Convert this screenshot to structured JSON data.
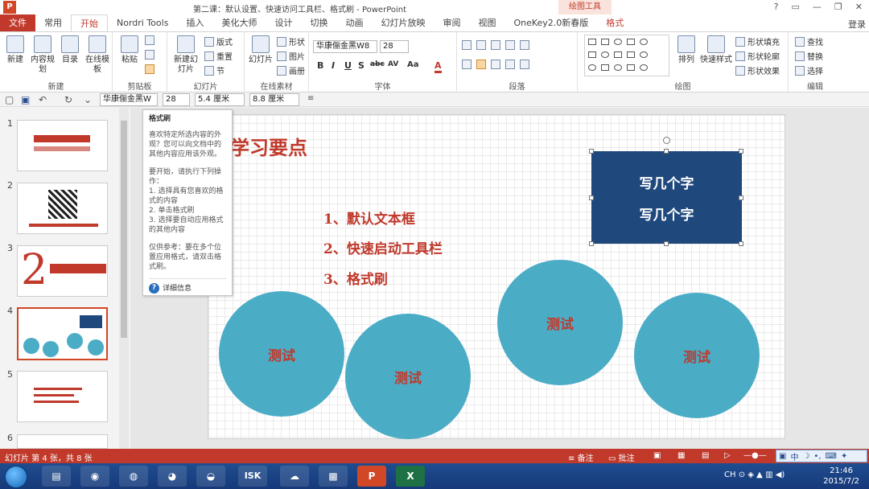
{
  "window": {
    "title": "第二课：默认设置、快速访问工具栏、格式刷 - PowerPoint",
    "contextual_label": "绘图工具",
    "controls": [
      "?",
      "▭",
      "—",
      "❐",
      "✕"
    ],
    "login": "登录"
  },
  "tabs": [
    "文件",
    "常用",
    "开始",
    "Nordri Tools",
    "插入",
    "美化大师",
    "设计",
    "切换",
    "动画",
    "幻灯片放映",
    "审阅",
    "视图",
    "OneKey2.0新春版",
    "格式"
  ],
  "ribbon": {
    "groups": {
      "new": "新建",
      "clipboard": "剪贴板",
      "slides": "幻灯片",
      "online": "在线素材",
      "font": "字体",
      "paragraph": "段落",
      "drawing": "绘图",
      "editing": "编辑"
    },
    "buttons": {
      "new": "新建",
      "content_plan": "内容规划",
      "toc": "目录",
      "online_template": "在线模板",
      "paste": "粘贴",
      "new_slide": "新建幻灯片",
      "layout": "版式",
      "reset": "重置",
      "section": "节",
      "slideshow": "幻灯片",
      "shape": "形状",
      "picture": "图片",
      "album": "画册",
      "arrange": "排列",
      "quick_styles": "快速样式",
      "shape_fill": "形状填充",
      "shape_outline": "形状轮廓",
      "shape_effects": "形状效果",
      "find": "查找",
      "replace": "替换",
      "select": "选择"
    },
    "font_name": "华康俪金黑W8",
    "font_size": "28",
    "fmt_buttons": [
      "B",
      "I",
      "U",
      "S",
      "abc",
      "AV",
      "Aa",
      "A"
    ]
  },
  "qat": {
    "font_name": "华康俪金黑W",
    "font_size": "28",
    "width": "5.4 厘米",
    "height": "8.8 厘米"
  },
  "thumbnails": [
    {
      "num": "1"
    },
    {
      "num": "2"
    },
    {
      "num": "3"
    },
    {
      "num": "4"
    },
    {
      "num": "5"
    },
    {
      "num": "6"
    }
  ],
  "tooltip": {
    "title": "格式刷",
    "desc": "喜欢特定所选内容的外观？您可以向文档中的其他内容应用该外观。",
    "how_title": "要开始，请执行下列操作：",
    "steps": [
      "1. 选择具有您喜欢的格式的内容",
      "2. 单击格式刷",
      "3. 选择要自动应用格式的其他内容"
    ],
    "tip": "仅供参考：要在多个位置应用格式，请双击格式刷。",
    "more": "详细信息"
  },
  "slide": {
    "title": "学习要点",
    "bullets": [
      "1、默认文本框",
      "2、快速启动工具栏",
      "3、格式刷"
    ],
    "box_lines": [
      "写几个字",
      "写几个字"
    ],
    "circles": [
      "测试",
      "测试",
      "测试",
      "测试"
    ]
  },
  "status": {
    "slide_info": "幻灯片 第 4 张，共 8 张",
    "notes": "备注",
    "comments": "批注"
  },
  "ime": "中",
  "taskbar": {
    "time": "21:46",
    "date": "2015/7/2",
    "lang": "CH"
  },
  "colors": {
    "accent": "#c0392b",
    "circle": "#4bacc6",
    "box": "#1f497d"
  }
}
